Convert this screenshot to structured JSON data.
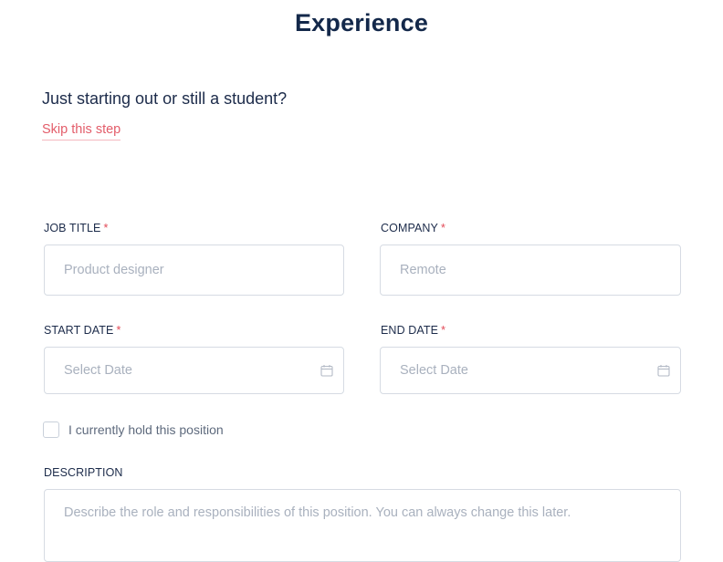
{
  "header": {
    "title": "Experience"
  },
  "intro": {
    "question": "Just starting out or still a student?",
    "skip_label": "Skip this step"
  },
  "form": {
    "job_title": {
      "label": "JOB TITLE",
      "required": "*",
      "placeholder": "Product designer",
      "value": ""
    },
    "company": {
      "label": "COMPANY",
      "required": "*",
      "placeholder": "Remote",
      "value": ""
    },
    "start_date": {
      "label": "START DATE",
      "required": "*",
      "placeholder": "Select Date",
      "icon": "calendar-icon"
    },
    "end_date": {
      "label": "END DATE",
      "required": "*",
      "placeholder": "Select Date",
      "icon": "calendar-icon"
    },
    "current_position": {
      "label": "I currently hold this position",
      "checked": false
    },
    "description": {
      "label": "DESCRIPTION",
      "placeholder": "Describe the role and responsibilities of this position. You can always change this later."
    }
  },
  "colors": {
    "title": "#13284a",
    "accent_link": "#e35d6a",
    "required_marker": "#e24a57",
    "border": "#d6dbe3",
    "placeholder": "#a9b1be"
  }
}
